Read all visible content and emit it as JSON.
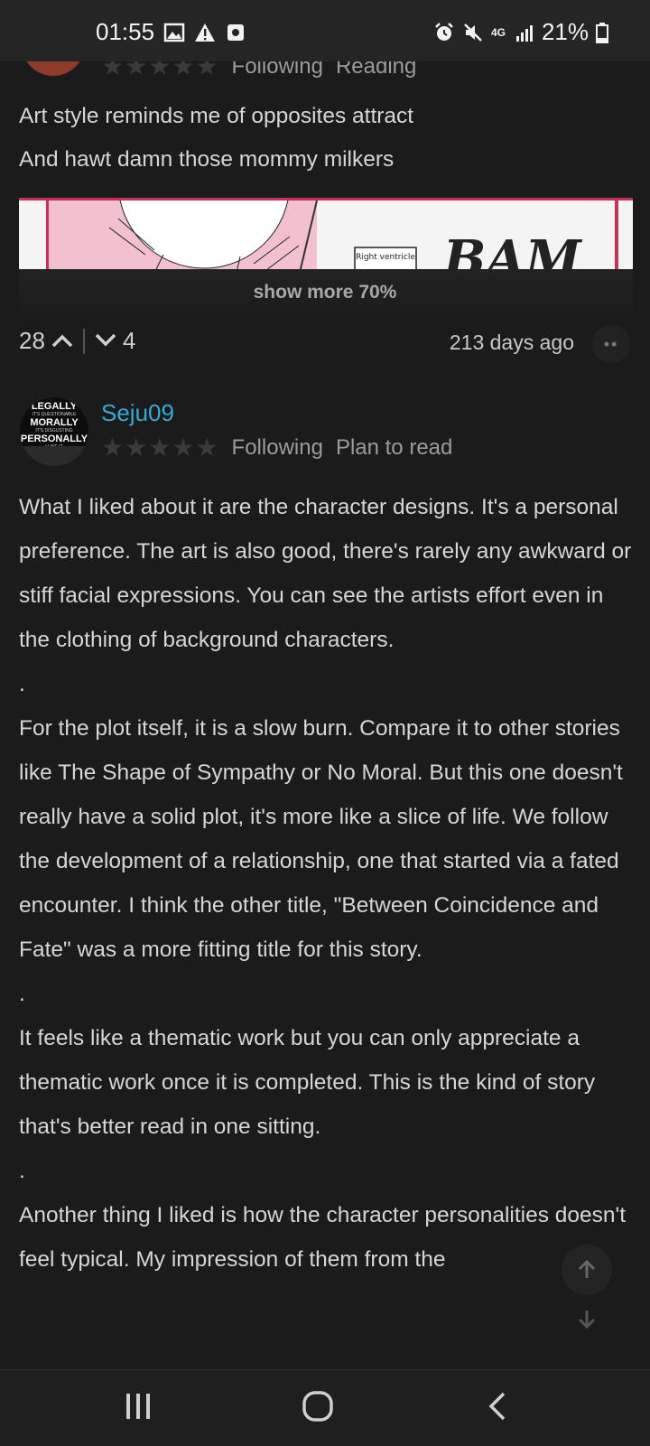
{
  "status_bar": {
    "time": "01:55",
    "network": "4G",
    "battery": "21%"
  },
  "review1": {
    "tags": [
      "Following",
      "Reading"
    ],
    "lines": [
      "Art style reminds me of opposites attract",
      "And hawt damn those mommy milkers"
    ],
    "image_texts": {
      "bubble": "Right ventricle",
      "sfx": "BAM"
    },
    "show_more": "show more 70%",
    "upvotes": "28",
    "downvotes": "4",
    "time_ago": "213 days ago"
  },
  "review2": {
    "avatar_text": [
      "LEGALLY",
      "IT'S QUESTIONABLE",
      "MORALLY",
      "IT'S DISGUSTING",
      "PERSONALLY",
      "I LIKE IT"
    ],
    "username": "Seju09",
    "tags": [
      "Following",
      "Plan to read"
    ],
    "paragraphs": [
      "What I liked about it are the character designs. It's a personal preference. The art is also good, there's rarely any awkward or stiff facial expressions. You can see the artists effort even in the clothing of background characters.",
      ".",
      "For the plot itself, it is a slow burn. Compare it to other stories like The Shape of Sympathy or No Moral. But this one doesn't really have a solid plot, it's more like a slice of life. We follow the development of a relationship, one that started via a fated encounter. I think the other title, \"Between Coincidence and Fate\" was a more fitting title for this story.",
      ".",
      "It feels like a thematic work but you can only appreciate a thematic work once it is completed. This is the kind of story that's better read in one sitting.",
      ".",
      "Another thing I liked is how the character personalities doesn't feel typical. My impression of them from the"
    ]
  },
  "colors": {
    "background": "#1b1b1c",
    "username": "#3aa7d9",
    "text": "#d6d6d6"
  }
}
